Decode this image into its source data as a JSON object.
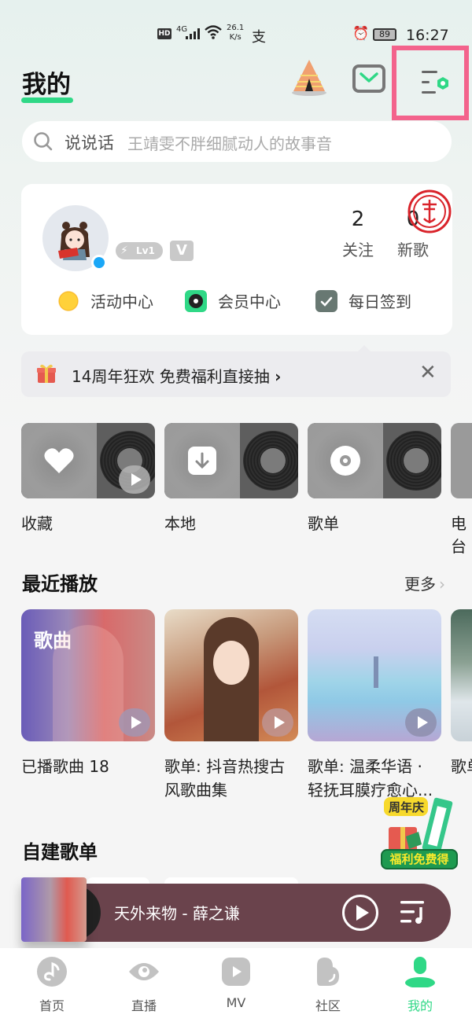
{
  "status_bar": {
    "hd": "HD",
    "network": "4G",
    "speed_value": "26.1",
    "speed_unit": "K/s",
    "alipay_glyph": "支",
    "battery": "89",
    "time": "16:27"
  },
  "header": {
    "title": "我的",
    "icons": [
      "tent-icon",
      "mail-icon",
      "settings-list-icon"
    ]
  },
  "search": {
    "label": "说说话",
    "placeholder": "王靖雯不胖细腻动人的故事音"
  },
  "profile": {
    "level": "Lv1",
    "vip_badge": "V",
    "stats": [
      {
        "value": "2",
        "label": "关注"
      },
      {
        "value": "0",
        "label": "新歌"
      }
    ],
    "quick_links": [
      {
        "label": "活动中心",
        "icon": "sun-badge-icon"
      },
      {
        "label": "会员中心",
        "icon": "turntable-icon"
      },
      {
        "label": "每日签到",
        "icon": "calendar-check-icon"
      }
    ]
  },
  "banner": {
    "text": "14周年狂欢 免费福利直接抽",
    "chevron": "›",
    "close": "✕"
  },
  "library": [
    {
      "label": "收藏",
      "icon": "heart-icon"
    },
    {
      "label": "本地",
      "icon": "download-icon"
    },
    {
      "label": "歌单",
      "icon": "disc-icon"
    },
    {
      "label": "电台",
      "icon": "radio-icon"
    }
  ],
  "recent": {
    "title": "最近播放",
    "more": "更多",
    "cover_tag": "歌曲",
    "items": [
      {
        "label": "已播歌曲 18"
      },
      {
        "label": "歌单: 抖音热搜古风歌曲集"
      },
      {
        "label": "歌单: 温柔华语 · 轻抚耳膜疗愈心..."
      },
      {
        "label": "歌单精选"
      }
    ]
  },
  "promo": {
    "tag": "周年庆",
    "cta": "福利免费得"
  },
  "custom_playlists": {
    "title": "自建歌单"
  },
  "mini_player": {
    "song": "天外来物 - 薛之谦"
  },
  "tabs": [
    {
      "label": "首页",
      "icon": "music-note-icon"
    },
    {
      "label": "直播",
      "icon": "eye-icon"
    },
    {
      "label": "MV",
      "icon": "video-play-icon"
    },
    {
      "label": "社区",
      "icon": "community-icon"
    },
    {
      "label": "我的",
      "icon": "person-icon",
      "active": true
    }
  ],
  "colors": {
    "accent": "#2fd886",
    "highlight_box": "#f3638c",
    "mini_player_bg": "#6a434c"
  }
}
